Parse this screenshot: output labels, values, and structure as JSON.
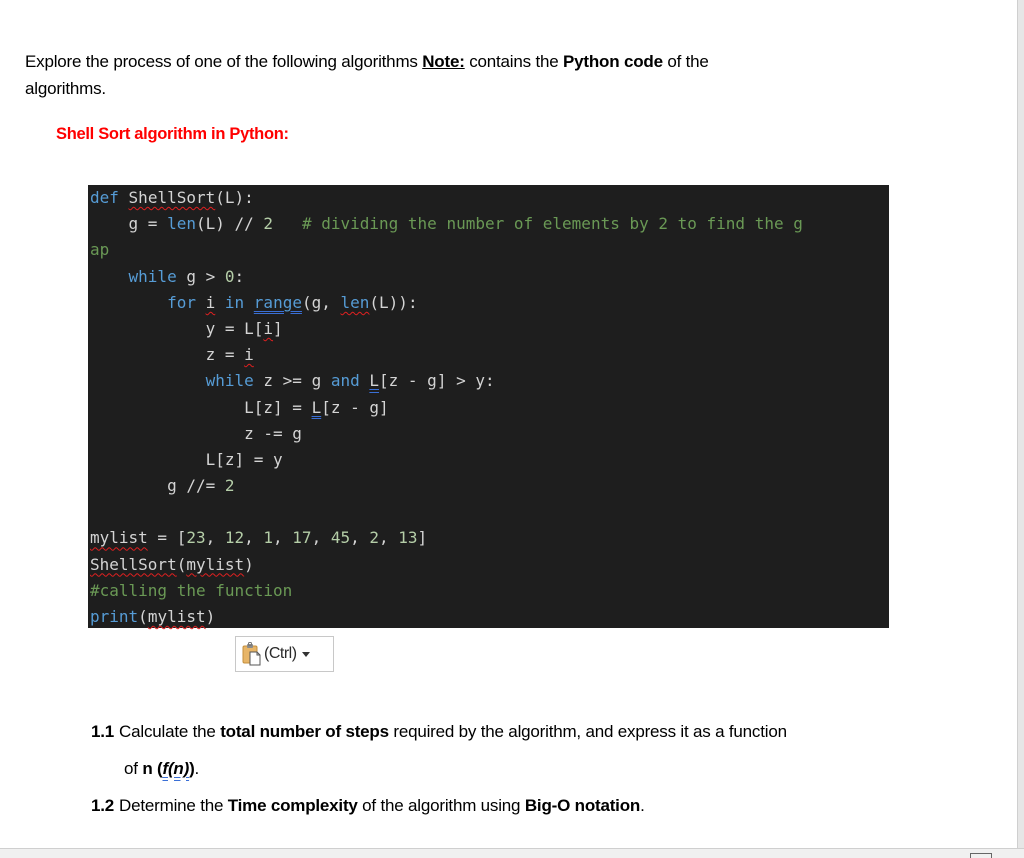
{
  "intro": {
    "text_before": "Explore the process of one of the following algorithms ",
    "note_label": "Note:",
    "text_middle": " contains the ",
    "bold_phrase": "Python code",
    "text_after_line1": " of the",
    "text_line2": "algorithms."
  },
  "section_title": "Shell Sort algorithm in Python:",
  "code": {
    "colors": {
      "background": "#1e1e1e",
      "default": "#d4d4d4",
      "keyword": "#569cd6",
      "comment": "#6a9955",
      "number": "#b5cea8"
    },
    "lines": [
      "def ShellSort(L):",
      "    g = len(L) // 2   # dividing the number of elements by 2 to find the g",
      "ap",
      "    while g > 0:",
      "        for i in range(g, len(L)):",
      "            y = L[i]",
      "            z = i",
      "            while z >= g and L[z - g] > y:",
      "                L[z] = L[z - g]",
      "                z -= g",
      "            L[z] = y",
      "        g //= 2",
      "",
      "mylist = [23, 12, 1, 17, 45, 2, 13]",
      "ShellSort(mylist)",
      "#calling the function",
      "print(mylist)"
    ],
    "tokens": {
      "def": "def",
      "func_name": "ShellSort",
      "param": "(L):",
      "g_assign": "g = ",
      "len": "len",
      "len_args": "(L) // ",
      "two": "2",
      "comment1": "# dividing the number of elements by 2 to find the g",
      "comment1_wrap": "ap",
      "while": "while",
      "while_cond": " g > ",
      "zero": "0",
      "colon": ":",
      "for": "for",
      "i": "i",
      "in": "in",
      "range": "range",
      "range_args": "(g, ",
      "len_close": "(L)):",
      "y_assign": "y = L[",
      "y_close": "]",
      "z_assign": "z = ",
      "while_inner_cond1": " z >= g ",
      "and": "and",
      "L_first": "L",
      "while_inner_cond2": "[z - g] > y:",
      "shift_left": "L[z] = ",
      "shift_right": "[z - g]",
      "z_dec": "z -= g",
      "place": "L[z] = y",
      "g_div": "g //= ",
      "mylist": "mylist",
      "list_eq": " = [",
      "list_values": [
        "23",
        "12",
        "1",
        "17",
        "45",
        "2",
        "13"
      ],
      "list_sep": ", ",
      "list_close": "]",
      "call_name": "ShellSort",
      "paren_open": "(",
      "paren_close": ")",
      "comment2": "#calling the function",
      "print": "print"
    }
  },
  "paste_button": {
    "icon": "clipboard-paste-icon",
    "label": "(Ctrl)",
    "dropdown_icon": "caret-down-icon"
  },
  "questions": [
    {
      "number": "1.1",
      "text_before": "Calculate the ",
      "bold": "total number of steps",
      "text_after": " required by the algorithm, and express it as a function",
      "line2_before": "of ",
      "line2_bold": "n",
      "line2_fn_open": " (",
      "line2_fn": "f(n)",
      "line2_after": " ).",
      "line2_end": "."
    },
    {
      "number": "1.2",
      "text_before": "Determine the ",
      "bold": "Time complexity",
      "text_middle": " of the algorithm using ",
      "bold2": "Big-O notation",
      "text_after": "."
    }
  ]
}
